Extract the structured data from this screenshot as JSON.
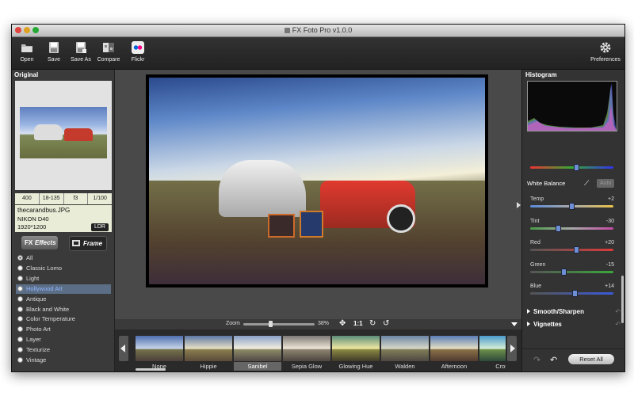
{
  "window": {
    "title": "FX Foto Pro v1.0.0"
  },
  "toolbar": {
    "open": "Open",
    "save": "Save",
    "save_as": "Save As",
    "compare": "Compare",
    "flickr": "Flickr",
    "preferences": "Preferences"
  },
  "left": {
    "original_title": "Original",
    "meta": [
      "400",
      "18-135",
      "f3",
      "1/100"
    ],
    "filename": "thecarandbus.JPG",
    "camera": "NIKON D40",
    "resolution": "1920*1200",
    "badge": "LDR",
    "tabs": {
      "effects": "Effects",
      "frame": "Frame"
    },
    "effects": [
      "All",
      "Classic Lomo",
      "Light",
      "Hollywood Art",
      "Antique",
      "Black and White",
      "Color Temperature",
      "Photo Art",
      "Layer",
      "Texturize",
      "Vintage"
    ],
    "selected_effect": "Hollywood Art"
  },
  "center": {
    "zoom_label": "Zoom",
    "zoom_value": "38%",
    "zoom_fraction": 0.38,
    "one_to_one": "1:1",
    "thumbnails": [
      "None",
      "Hippie",
      "Sanibel",
      "Sepia Glow",
      "Glowing Hue",
      "Walden",
      "Afternoon",
      "Cross"
    ],
    "selected_thumb": "Sanibel"
  },
  "right": {
    "histogram_title": "Histogram",
    "white_balance": "White Balance",
    "auto": "Auto",
    "sliders": [
      {
        "label": "Temp",
        "value": "+2",
        "pos": 0.52
      },
      {
        "label": "Tint",
        "value": "-30",
        "pos": 0.35
      },
      {
        "label": "Red",
        "value": "+20",
        "pos": 0.58
      },
      {
        "label": "Green",
        "value": "-15",
        "pos": 0.42
      },
      {
        "label": "Blue",
        "value": "+14",
        "pos": 0.56
      }
    ],
    "top_slider_pos": 0.58,
    "smooth_sharpen": "Smooth/Sharpen",
    "vignettes": "Vignettes",
    "reset_all": "Reset All"
  },
  "colors": {
    "accent": "#5b6e86",
    "selected_text": "#8fb6ff",
    "panel": "#3a3a3a"
  }
}
